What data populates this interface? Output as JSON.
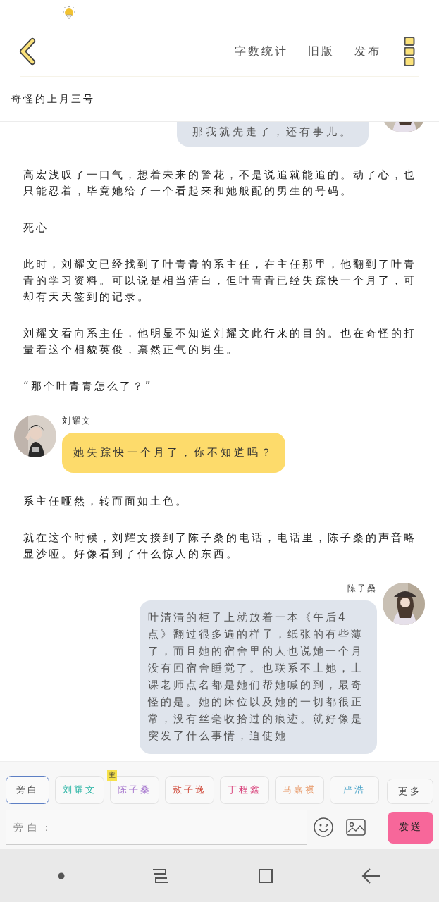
{
  "toolbar": {
    "actions": [
      "字数统计",
      "旧版",
      "发布"
    ]
  },
  "title": "奇怪的上月三号",
  "content": [
    {
      "kind": "outgoing",
      "text": "那我就先走了，还有事儿。"
    },
    {
      "kind": "paragraph",
      "text": "高宏浅叹了一口气，想着未来的警花，不是说追就能追的。动了心，也只能忍着，毕竟她给了一个看起来和她般配的男生的号码。"
    },
    {
      "kind": "paragraph",
      "text": "死心"
    },
    {
      "kind": "paragraph",
      "text": "此时，刘耀文已经找到了叶青青的系主任，在主任那里，他翻到了叶青青的学习资料。可以说是相当清白，但叶青青已经失踪快一个月了，可却有天天签到的记录。"
    },
    {
      "kind": "paragraph",
      "text": "刘耀文看向系主任，他明显不知道刘耀文此行来的目的。也在奇怪的打量着这个相貌英俊，禀然正气的男生。"
    },
    {
      "kind": "paragraph",
      "text": "“那个叶青青怎么了？”"
    },
    {
      "kind": "incoming",
      "speaker": "刘耀文",
      "text": "她失踪快一个月了，你不知道吗？"
    },
    {
      "kind": "paragraph",
      "text": "系主任哑然，转而面如土色。"
    },
    {
      "kind": "paragraph",
      "text": "就在这个时候，刘耀文接到了陈子桑的电话，电话里，陈子桑的声音略显沙哑。好像看到了什么惊人的东西。"
    },
    {
      "kind": "outgoing",
      "speaker": "陈子桑",
      "text": "叶清清的柜子上就放着一本《午后4点》翻过很多遍的样子，纸张的有些薄了，而且她的宿舍里的人也说她一个月没有回宿舍睡觉了。也联系不上她，上课老师点名都是她们帮她喊的到，最奇怪的是。她的床位以及她的一切都很正常，没有丝毫收拾过的痕迹。就好像是突发了什么事情，迫使她"
    }
  ],
  "roles": [
    {
      "label": "旁白",
      "selected": true,
      "color": "#555555"
    },
    {
      "label": "刘耀文",
      "selected": false,
      "color": "#2ab5a5"
    },
    {
      "label": "陈子桑",
      "selected": false,
      "color": "#a97bd0",
      "badge": "主"
    },
    {
      "label": "敖子逸",
      "selected": false,
      "color": "#d04a3a"
    },
    {
      "label": "丁程鑫",
      "selected": false,
      "color": "#d8407a"
    },
    {
      "label": "马嘉祺",
      "selected": false,
      "color": "#e89a6a"
    },
    {
      "label": "严浩",
      "selected": false,
      "color": "#4aa3c8"
    }
  ],
  "more_button": "更多",
  "input": {
    "placeholder": "旁白："
  },
  "send_button": "发送"
}
